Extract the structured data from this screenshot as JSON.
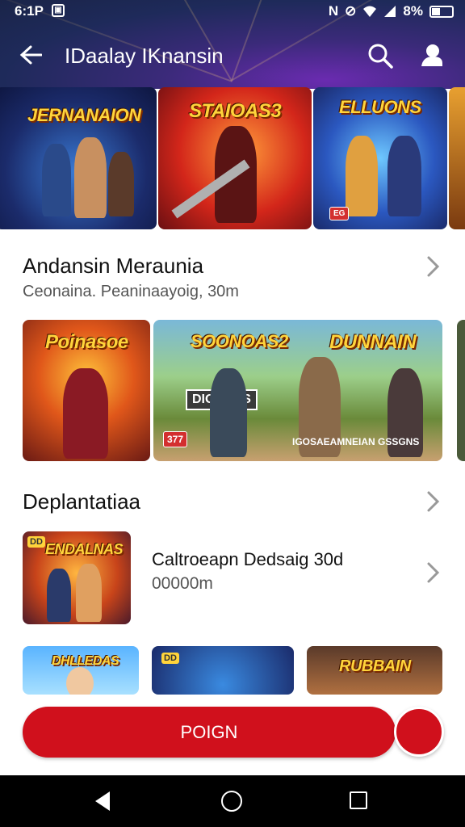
{
  "status": {
    "time": "6:1P",
    "battery": "8%"
  },
  "header": {
    "title": "IDaalay IKnansin"
  },
  "top_carousel": [
    {
      "title": "JERNANAION"
    },
    {
      "title": "STAIOAS3"
    },
    {
      "title": "ELLUONS",
      "badge": "EG"
    }
  ],
  "section1": {
    "title": "Andansin Meraunia",
    "subtitle": "Ceonaina. Peaninaayoig, 30m"
  },
  "row2": [
    {
      "title": "Poinasoe"
    },
    {
      "title": "SOONOAS2",
      "title2": "DUNNAIN",
      "banner": "DIOMIAIS",
      "badge": "377",
      "caption": "IGOSAEAMNEIAN  GSSGNS"
    }
  ],
  "section2": {
    "title": "Deplantatiaa"
  },
  "list_item": {
    "title": "Caltroeapn Dedsaig 30d",
    "subtitle": "00000m",
    "thumb_title": "ENDALNAS",
    "thumb_badge": "DD"
  },
  "bottom_row": [
    {
      "title": "DHLLEDAS"
    },
    {
      "title": "",
      "badge": "DD"
    },
    {
      "title": "RUBBAIN"
    }
  ],
  "primary_button": {
    "label": "POIGN"
  }
}
